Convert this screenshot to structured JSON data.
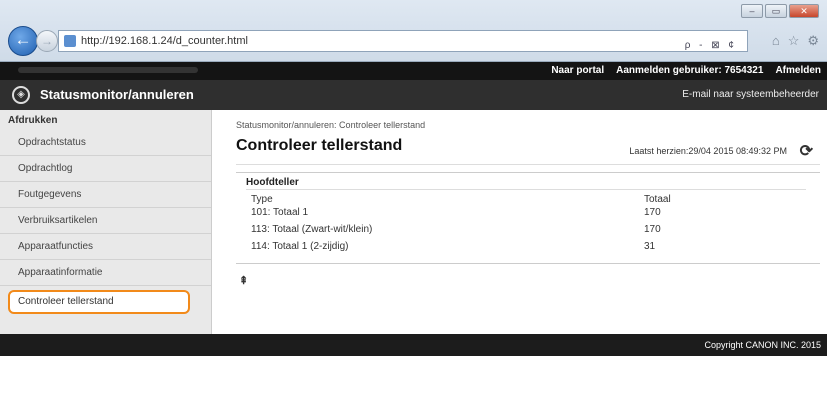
{
  "browser": {
    "url": "http://192.168.1.24/d_counter.html",
    "address_tools": "ρ - ⊠ ¢",
    "icons": [
      "home-icon",
      "star-icon",
      "gear-icon"
    ]
  },
  "topbar": {
    "portal": "Naar portal",
    "login_label": "Aanmelden gebruiker:",
    "login_user": "7654321",
    "logout": "Afmelden"
  },
  "header": {
    "title": "Statusmonitor/annuleren",
    "mail": "E-mail naar systeembeheerder"
  },
  "sidebar": {
    "heading": "Afdrukken",
    "items": [
      {
        "label": "Opdrachtstatus"
      },
      {
        "label": "Opdrachtlog"
      },
      {
        "label": "Foutgegevens"
      },
      {
        "label": "Verbruiksartikelen"
      },
      {
        "label": "Apparaatfuncties"
      },
      {
        "label": "Apparaatinformatie"
      },
      {
        "label": "Controleer tellerstand"
      }
    ]
  },
  "main": {
    "breadcrumb": "Statusmonitor/annuleren: Controleer tellerstand",
    "title": "Controleer tellerstand",
    "updated": "Laatst herzien:29/04 2015 08:49:32 PM",
    "section": "Hoofdteller",
    "columns": [
      "Type",
      "Totaal"
    ],
    "rows": [
      {
        "type": "101: Totaal 1",
        "total": "170"
      },
      {
        "type": "113: Totaal (Zwart-wit/klein)",
        "total": "170"
      },
      {
        "type": "114: Totaal 1 (2-zijdig)",
        "total": "31"
      }
    ]
  },
  "footer": {
    "copyright": "Copyright CANON INC. 2015"
  }
}
